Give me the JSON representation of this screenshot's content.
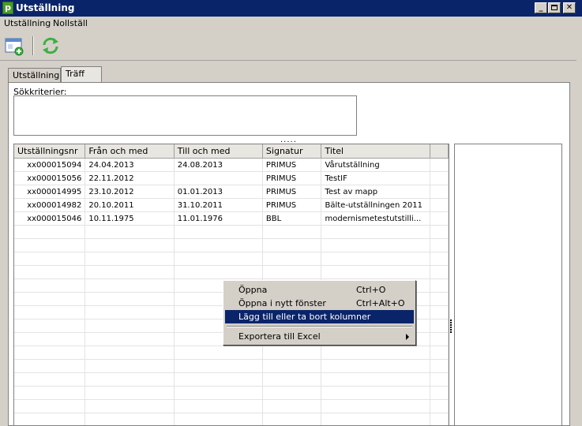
{
  "window": {
    "title": "Utställning"
  },
  "menu": {
    "items": [
      "Utställning",
      "Nollställ"
    ]
  },
  "toolbar": {
    "buttons": [
      "new-window-icon",
      "refresh-icon"
    ]
  },
  "tabs": [
    {
      "label": "Utställning",
      "active": false
    },
    {
      "label": "Träff",
      "active": true
    }
  ],
  "search": {
    "label": "Sökkriterier:",
    "value": ""
  },
  "splitter": {
    "grip": "....."
  },
  "grid": {
    "columns": [
      "Utställningsnr",
      "Från och med",
      "Till och med",
      "Signatur",
      "Titel"
    ],
    "rows": [
      [
        "xx000015094",
        "24.04.2013",
        "24.08.2013",
        "PRIMUS",
        "Vårutställning"
      ],
      [
        "xx000015056",
        "22.11.2012",
        "",
        "PRIMUS",
        "TestIF"
      ],
      [
        "xx000014995",
        "23.10.2012",
        "01.01.2013",
        "PRIMUS",
        "Test av mapp"
      ],
      [
        "xx000014982",
        "20.10.2011",
        "31.10.2011",
        "PRIMUS",
        "Bälte-utställningen 2011"
      ],
      [
        "xx000015046",
        "10.11.1975",
        "11.01.1976",
        "BBL",
        "modernismetestutstilli..."
      ]
    ]
  },
  "context_menu": {
    "items": [
      {
        "label": "Öppna",
        "shortcut": "Ctrl+O"
      },
      {
        "label": "Öppna i nytt fönster",
        "shortcut": "Ctrl+Alt+O"
      },
      {
        "label": "Lägg till eller ta bort kolumner",
        "shortcut": "",
        "highlighted": true
      },
      {
        "label": "Exportera till Excel",
        "shortcut": "",
        "submenu": true
      }
    ]
  },
  "colors": {
    "titlebar": "#0a246a",
    "highlight": "#0a246a",
    "app_icon": "#4a9c2a",
    "refresh": "#3cb043"
  }
}
